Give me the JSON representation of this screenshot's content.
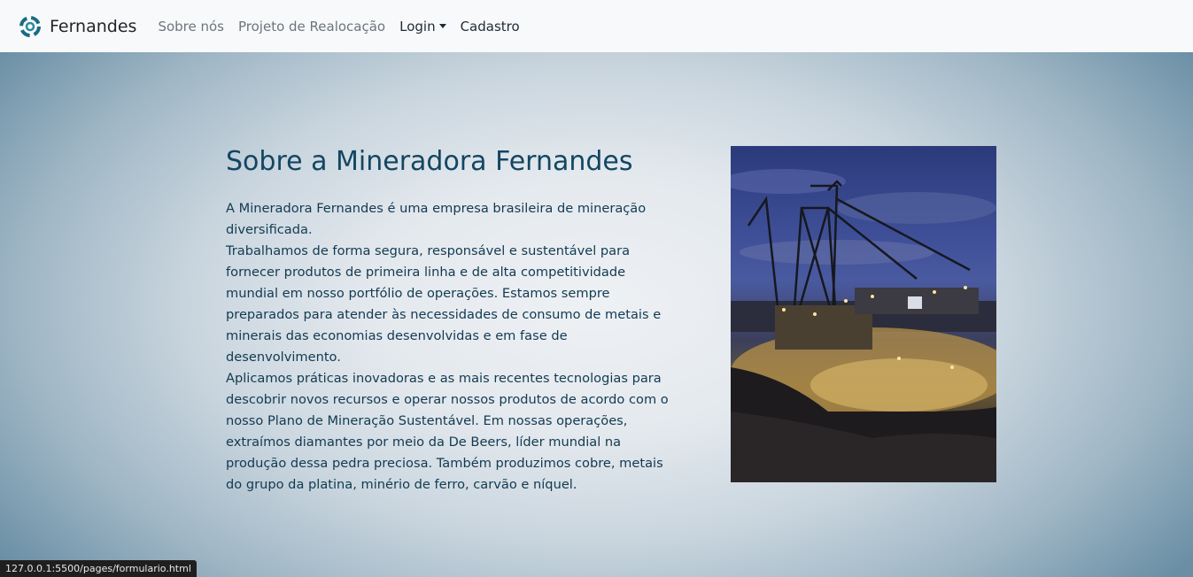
{
  "navbar": {
    "brand": "Fernandes",
    "logo_icon": "brand-logo-icon",
    "links": {
      "about": "Sobre nós",
      "project": "Projeto de Realocação",
      "login": "Login",
      "signup": "Cadastro"
    }
  },
  "hero": {
    "title": "Sobre a Mineradora Fernandes",
    "paragraphs": [
      "A Mineradora Fernandes é uma empresa brasileira de mineração diversificada.",
      "Trabalhamos de forma segura, responsável e sustentável para fornecer produtos de primeira linha e de alta competitividade mundial em nosso portfólio de operações. Estamos sempre preparados para atender às necessidades de consumo de metais e minerais das economias desenvolvidas e em fase de desenvolvimento.",
      "Aplicamos práticas inovadoras e as mais recentes tecnologias para descobrir novos recursos e operar nossos produtos de acordo com o nosso Plano de Mineração Sustentável. Em nossas operações, extraímos diamantes por meio da De Beers, líder mundial na produção dessa pedra preciosa. Também produzimos cobre, metais do grupo da platina, minério de ferro, carvão e níquel."
    ],
    "image_icon": "mining-excavator-photo"
  },
  "statusbar": {
    "url": "127.0.0.1:5500/pages/formulario.html"
  },
  "colors": {
    "navbar_bg": "#f8f9fa",
    "title": "#124662",
    "text": "#123a52",
    "logo": "#1a6b84"
  }
}
